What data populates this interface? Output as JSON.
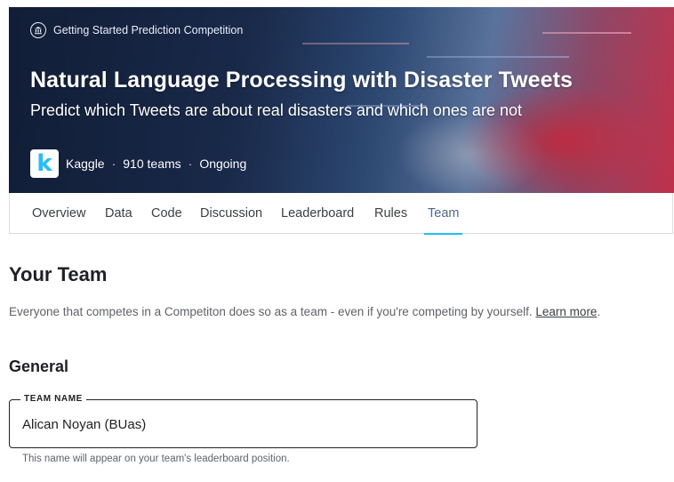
{
  "competition": {
    "category": "Getting Started Prediction Competition",
    "title": "Natural Language Processing with Disaster Tweets",
    "subtitle": "Predict which Tweets are about real disasters and which ones are not",
    "host_logo_letter": "k",
    "host": "Kaggle",
    "teams": "910 teams",
    "status": "Ongoing",
    "separator": "·",
    "category_icon": "bank-icon",
    "colors": {
      "accent": "#20beff",
      "active_tab_text": "#4c6a90"
    }
  },
  "tabs": [
    {
      "label": "Overview",
      "active": false
    },
    {
      "label": "Data",
      "active": false
    },
    {
      "label": "Code",
      "active": false
    },
    {
      "label": "Discussion",
      "active": false
    },
    {
      "label": "Leaderboard",
      "active": false
    },
    {
      "label": "Rules",
      "active": false
    },
    {
      "label": "Team",
      "active": true
    }
  ],
  "team_section": {
    "heading": "Your Team",
    "intro": "Everyone that competes in a Competiton does so as a team - even if you're competing by yourself.",
    "learn_more": "Learn more",
    "intro_end": "."
  },
  "general_section": {
    "heading": "General",
    "team_name_label": "TEAM NAME",
    "team_name_value": "Alican Noyan (BUas)",
    "helper": "This name will appear on your team's leaderboard position."
  }
}
